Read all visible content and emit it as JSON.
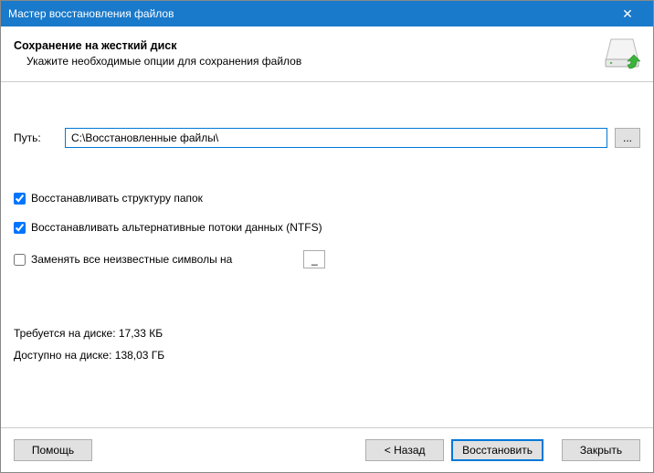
{
  "window": {
    "title": "Мастер восстановления файлов"
  },
  "header": {
    "title": "Сохранение на жесткий диск",
    "subtitle": "Укажите необходимые опции для сохранения файлов"
  },
  "path": {
    "label": "Путь:",
    "value": "C:\\Восстановленные файлы\\",
    "browse": "..."
  },
  "options": {
    "restore_structure": "Восстанавливать структуру папок",
    "restore_alt_streams": "Восстанавливать альтернативные потоки данных (NTFS)",
    "replace_unknown": "Заменять все неизвестные символы на",
    "replace_value": "_"
  },
  "disk": {
    "required": "Требуется на диске: 17,33 КБ",
    "available": "Доступно на диске: 138,03 ГБ"
  },
  "buttons": {
    "help": "Помощь",
    "back": "< Назад",
    "recover": "Восстановить",
    "close": "Закрыть"
  }
}
